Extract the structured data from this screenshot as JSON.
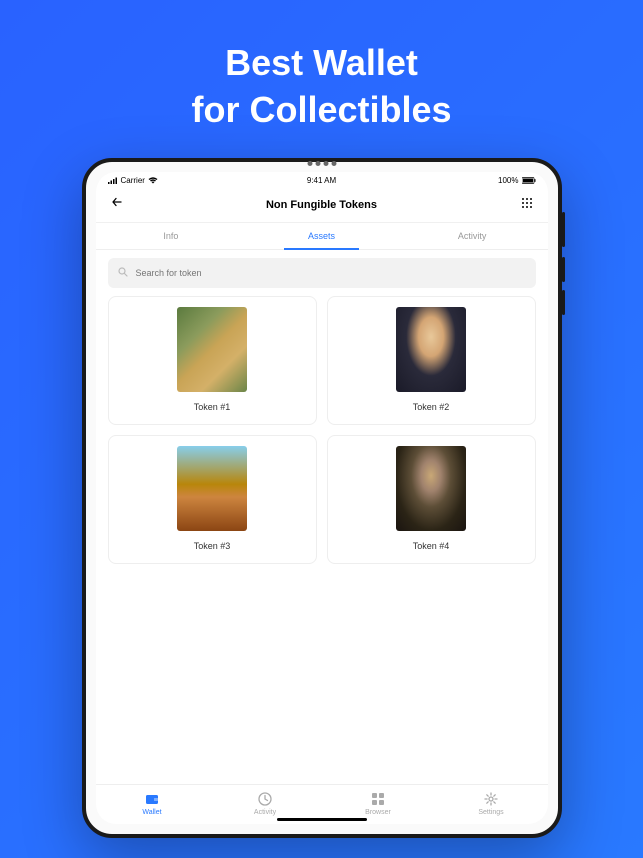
{
  "promo": {
    "line1": "Best Wallet",
    "line2": "for Collectibles"
  },
  "statusBar": {
    "carrier": "Carrier",
    "time": "9:41 AM",
    "battery": "100%"
  },
  "header": {
    "title": "Non Fungible Tokens"
  },
  "tabs": [
    {
      "label": "Info"
    },
    {
      "label": "Assets"
    },
    {
      "label": "Activity"
    }
  ],
  "search": {
    "placeholder": "Search for token"
  },
  "tokens": [
    {
      "label": "Token #1"
    },
    {
      "label": "Token #2"
    },
    {
      "label": "Token #3"
    },
    {
      "label": "Token #4"
    }
  ],
  "bottomNav": [
    {
      "label": "Wallet"
    },
    {
      "label": "Activity"
    },
    {
      "label": "Browser"
    },
    {
      "label": "Settings"
    }
  ]
}
